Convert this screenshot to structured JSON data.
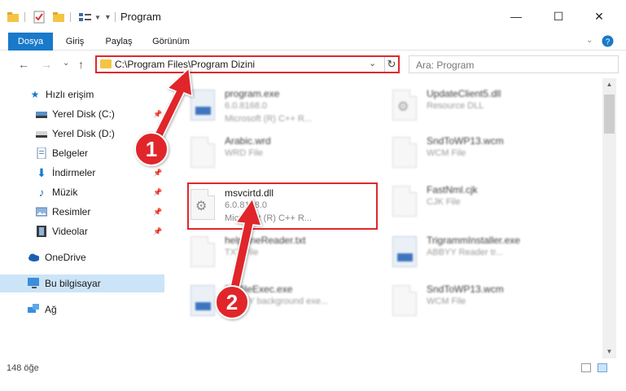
{
  "window": {
    "title": "Program",
    "controls": {
      "minimize": "—",
      "maximize": "☐",
      "close": "✕"
    }
  },
  "ribbon": {
    "tabs": [
      {
        "label": "Dosya",
        "active": true
      },
      {
        "label": "Giriş"
      },
      {
        "label": "Paylaş"
      },
      {
        "label": "Görünüm"
      }
    ],
    "collapse_icon": "chevron-down-icon",
    "help_icon": "help-icon"
  },
  "nav": {
    "back": "←",
    "forward": "→",
    "recent": "⌄",
    "up": "↑",
    "address": "C:\\Program Files\\Program Dizini",
    "refresh": "↻",
    "search_placeholder": "Ara: Program"
  },
  "sidebar": {
    "items": [
      {
        "label": "Hızlı erişim",
        "icon": "star-icon"
      },
      {
        "label": "Yerel Disk (C:)",
        "icon": "drive-icon",
        "pinned": true
      },
      {
        "label": "Yerel Disk (D:)",
        "icon": "drive-icon",
        "pinned": true
      },
      {
        "label": "Belgeler",
        "icon": "documents-icon",
        "pinned": true
      },
      {
        "label": "İndirmeler",
        "icon": "download-icon",
        "pinned": true
      },
      {
        "label": "Müzik",
        "icon": "music-icon",
        "pinned": true
      },
      {
        "label": "Resimler",
        "icon": "pictures-icon",
        "pinned": true
      },
      {
        "label": "Videolar",
        "icon": "video-icon",
        "pinned": true
      },
      {
        "label": "OneDrive",
        "icon": "cloud-icon"
      },
      {
        "label": "Bu bilgisayar",
        "icon": "computer-icon",
        "selected": true
      },
      {
        "label": "Ağ",
        "icon": "network-icon"
      }
    ]
  },
  "files": [
    {
      "name": "program.exe",
      "line1": "6.0.8168.0",
      "line2": "Microsoft (R) C++ R...",
      "icon": "exe-icon"
    },
    {
      "name": "UpdateClient5.dll",
      "line1": "Resource DLL",
      "line2": "",
      "icon": "dll-icon"
    },
    {
      "name": "Arabic.wrd",
      "line1": "WRD File",
      "line2": "",
      "icon": "file-icon"
    },
    {
      "name": "SndToWP13.wcm",
      "line1": "WCM File",
      "line2": "",
      "icon": "file-icon"
    },
    {
      "name": "msvcirtd.dll",
      "line1": "6.0.8168.0",
      "line2": "Microsoft (R) C++ R...",
      "icon": "dll-icon"
    },
    {
      "name": "FastNml.cjk",
      "line1": "CJK File",
      "line2": "",
      "icon": "file-icon"
    },
    {
      "name": "help.lineReader.txt",
      "line1": "TXT File",
      "line2": "",
      "icon": "file-icon"
    },
    {
      "name": "TrigrammInstaller.exe",
      "line1": "ABBYY Reader tr...",
      "line2": "",
      "icon": "app-icon"
    },
    {
      "name": "ProfileExec.exe",
      "line1": "ABBYY background exe...",
      "line2": "",
      "icon": "app-icon"
    },
    {
      "name": "SndToWP13.wcm",
      "line1": "WCM File",
      "line2": "",
      "icon": "file-icon"
    }
  ],
  "status": {
    "count": "148 öğe"
  },
  "annotations": {
    "badge1": "1",
    "badge2": "2",
    "color": "#e0282c"
  }
}
